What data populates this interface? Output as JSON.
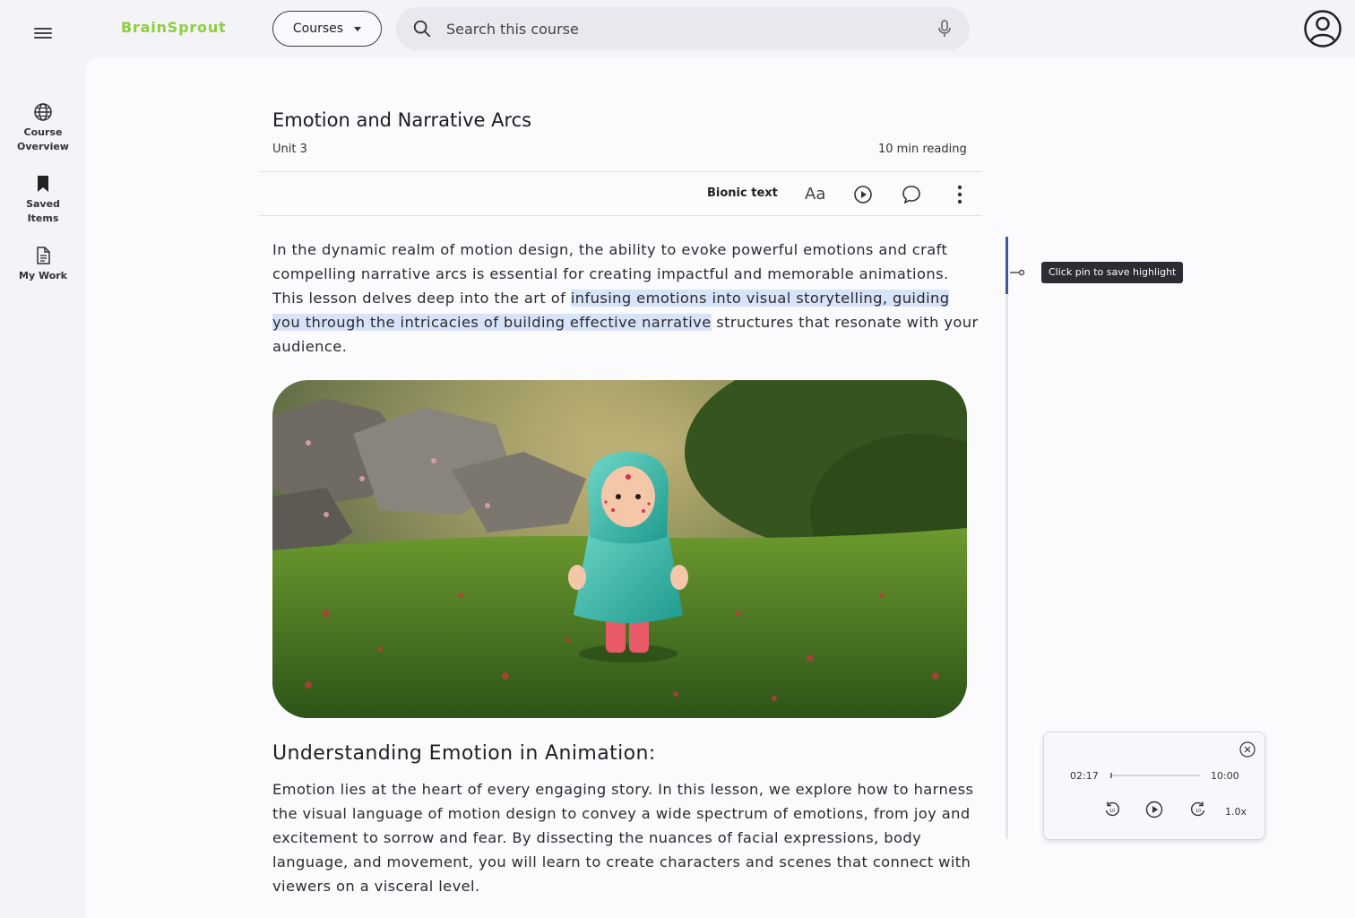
{
  "app": {
    "logo": "BrainSprout"
  },
  "header": {
    "courses_label": "Courses",
    "search_placeholder": "Search this course"
  },
  "sidebar": {
    "items": [
      {
        "label_line1": "Course",
        "label_line2": "Overview",
        "icon": "globe-icon"
      },
      {
        "label_line1": "Saved",
        "label_line2": "Items",
        "icon": "bookmark-icon"
      },
      {
        "label_line1": "My Work",
        "label_line2": "",
        "icon": "document-icon"
      }
    ]
  },
  "lesson": {
    "title": "Emotion and Narrative Arcs",
    "unit": "Unit 3",
    "reading_time": "10 min reading",
    "toolbar": {
      "bionic_label": "Bionic text",
      "font_label": "Aa"
    },
    "intro_before": "In the dynamic realm of motion design, the ability to evoke powerful emotions and craft compelling narrative arcs is essential for creating impactful and memorable animations. This lesson delves deep into the art of ",
    "intro_highlight": "infusing emotions into visual storytelling, guiding you through the intricacies of building effective narrative",
    "intro_after": " structures that resonate with your audience.",
    "subheading": "Understanding Emotion in Animation:",
    "body": "Emotion lies at the heart of every engaging story. In this lesson, we explore how to harness the visual language of motion design to convey a wide spectrum of emotions, from joy and excitement to sorrow and fear. By dissecting the nuances of facial expressions, body language, and movement, you will learn to create characters and scenes that connect with viewers on a visceral level."
  },
  "highlight": {
    "tooltip": "Click pin to save highlight"
  },
  "player": {
    "current_time": "02:17",
    "total_time": "10:00",
    "progress_fraction": 0.02,
    "speed": "1.0x"
  },
  "colors": {
    "brand": "#8ccf3a",
    "highlight": "#d7e4f7",
    "rail_active": "#3d5a99"
  }
}
